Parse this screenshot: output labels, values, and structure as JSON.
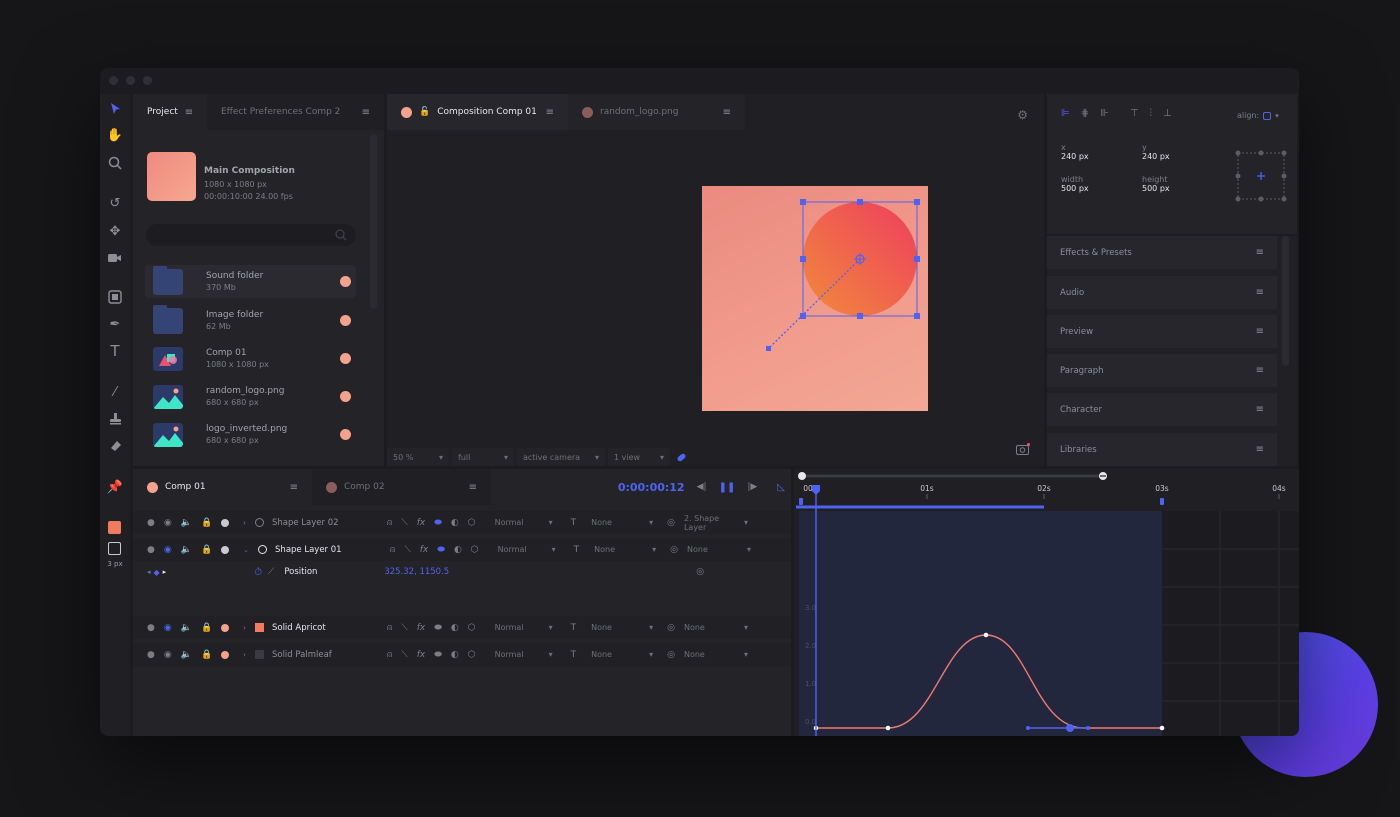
{
  "project_tabs": [
    {
      "label": "Project",
      "active": true
    },
    {
      "label": "Effect Preferences Comp 2",
      "active": false
    }
  ],
  "main_composition": {
    "name": "Main Composition",
    "size": "1080 x 1080 px",
    "timing": "00:00:10:00 24.00 fps"
  },
  "assets": [
    {
      "name": "Sound folder",
      "meta": "370 Mb",
      "kind": "folder"
    },
    {
      "name": "Image folder",
      "meta": "62 Mb",
      "kind": "folder"
    },
    {
      "name": "Comp 01",
      "meta": "1080 x 1080 px",
      "kind": "comp"
    },
    {
      "name": "random_logo.png",
      "meta": "680 x 680 px",
      "kind": "image"
    },
    {
      "name": "logo_inverted.png",
      "meta": "680 x 680 px",
      "kind": "image"
    }
  ],
  "viewer_tabs": [
    {
      "label": "Composition Comp 01",
      "active": true
    },
    {
      "label": "random_logo.png",
      "active": false
    }
  ],
  "viewer_footer": {
    "zoom": "50 %",
    "resolution": "full",
    "camera": "active camera",
    "views": "1 view"
  },
  "transform": {
    "x_label": "x",
    "x_value": "240 px",
    "y_label": "y",
    "y_value": "240 px",
    "width_label": "width",
    "width_value": "500 px",
    "height_label": "height",
    "height_value": "500 px",
    "align_label": "align:"
  },
  "side_panels": [
    "Effects & Presets",
    "Audio",
    "Preview",
    "Paragraph",
    "Character",
    "Libraries"
  ],
  "timeline_tabs": [
    {
      "label": "Comp 01",
      "active": true
    },
    {
      "label": "Comp 02",
      "active": false
    }
  ],
  "timecode": "0:00:00:12",
  "stroke_width": "3 px",
  "layers": [
    {
      "name": "Shape Layer 02",
      "mode": "Normal",
      "track": "None",
      "parent": "2. Shape Layer",
      "highlight": false
    },
    {
      "name": "Shape Layer 01",
      "mode": "Normal",
      "track": "None",
      "parent": "None",
      "highlight": true
    },
    {
      "name": "Solid Apricot",
      "mode": "Normal",
      "track": "None",
      "parent": "None",
      "highlight": true
    },
    {
      "name": "Solid Palmleaf",
      "mode": "Normal",
      "track": "None",
      "parent": "None",
      "highlight": false
    }
  ],
  "position_property": {
    "label": "Position",
    "value": "325.32, 1150.5"
  },
  "ruler": [
    "00s",
    "01s",
    "02s",
    "03s",
    "04s"
  ],
  "graph_axis": [
    "3.0",
    "2.0",
    "1.0",
    "0.0"
  ],
  "colors": {
    "accent": "#4f63f2",
    "peach": "#f5a28d",
    "panel": "#232328"
  }
}
